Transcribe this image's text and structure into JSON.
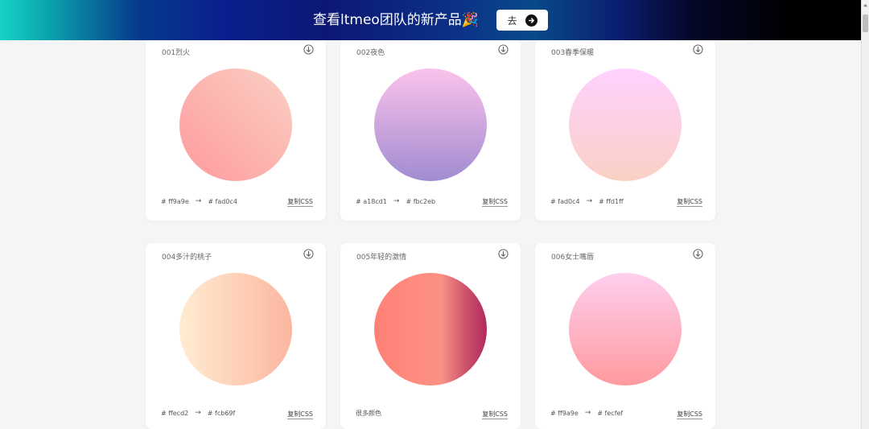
{
  "banner": {
    "title": "查看ltmeo团队的新产品🎉",
    "button_label": "去"
  },
  "copy_label": "复制CSS",
  "arrow_glyph": "→",
  "cards": [
    {
      "title": "001烈火",
      "from": "#ff9a9e",
      "to": "#fad0c4",
      "direction": "to top right",
      "stops_text": ""
    },
    {
      "title": "002夜色",
      "from": "#a18cd1",
      "to": "#fbc2eb",
      "direction": "to top",
      "stops_text": ""
    },
    {
      "title": "003春季保暖",
      "from": "#fad0c4",
      "to": "#ffd1ff",
      "direction": "to top",
      "stops_text": ""
    },
    {
      "title": "004多汁的桃子",
      "from": "#ffecd2",
      "to": "#fcb69f",
      "direction": "to right",
      "stops_text": ""
    },
    {
      "title": "005年轻的激情",
      "from": "",
      "to": "",
      "direction": "to right",
      "stops_text": "很多颜色",
      "gradient_stops": [
        "#ff8177",
        "#ff867a",
        "#ff8c7f",
        "#f99185",
        "#cf556c",
        "#b12a5b"
      ]
    },
    {
      "title": "006女士嘴唇",
      "from": "#ff9a9e",
      "to": "#fecfef",
      "direction": "to top",
      "stops_text": ""
    }
  ],
  "colors": {
    "page_bg": "#f5f5f5",
    "card_bg": "#ffffff"
  }
}
